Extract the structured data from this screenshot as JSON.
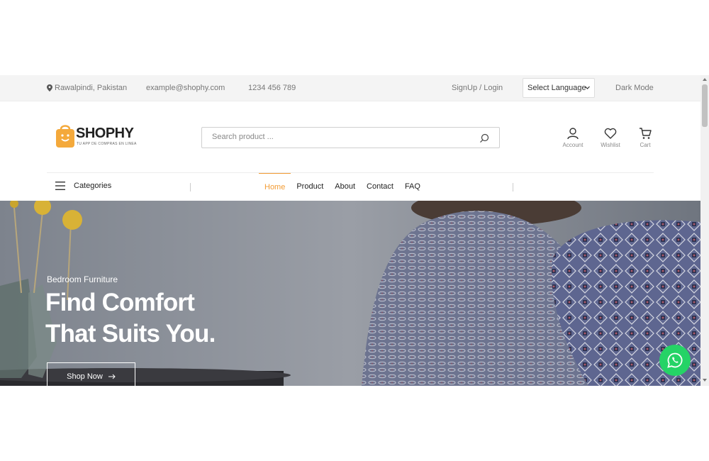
{
  "topbar": {
    "location": "Rawalpindi, Pakistan",
    "email": "example@shophy.com",
    "phone": "1234 456 789",
    "signup": "SignUp / Login",
    "language": "Select Language",
    "dark_mode": "Dark Mode"
  },
  "header": {
    "logo_text": "SHOPHY",
    "logo_sub": "TU APP DE COMPRAS EN LINEA",
    "search_placeholder": "Search product ...",
    "account": "Account",
    "wishlist": "Wishlist",
    "cart": "Cart"
  },
  "nav": {
    "categories": "Categories",
    "items": [
      "Home",
      "Product",
      "About",
      "Contact",
      "FAQ"
    ],
    "active": "Home"
  },
  "hero": {
    "subtitle": "Bedroom Furniture",
    "title_line1": "Find Comfort",
    "title_line2": "That Suits You.",
    "button": "Shop Now"
  },
  "colors": {
    "accent": "#f39c34",
    "whatsapp": "#25d366"
  },
  "icons": [
    "location-pin-icon",
    "chevron-down-icon",
    "shopping-bag-logo-icon",
    "search-icon",
    "user-icon",
    "heart-icon",
    "cart-icon",
    "hamburger-icon",
    "arrow-right-icon",
    "whatsapp-icon"
  ]
}
